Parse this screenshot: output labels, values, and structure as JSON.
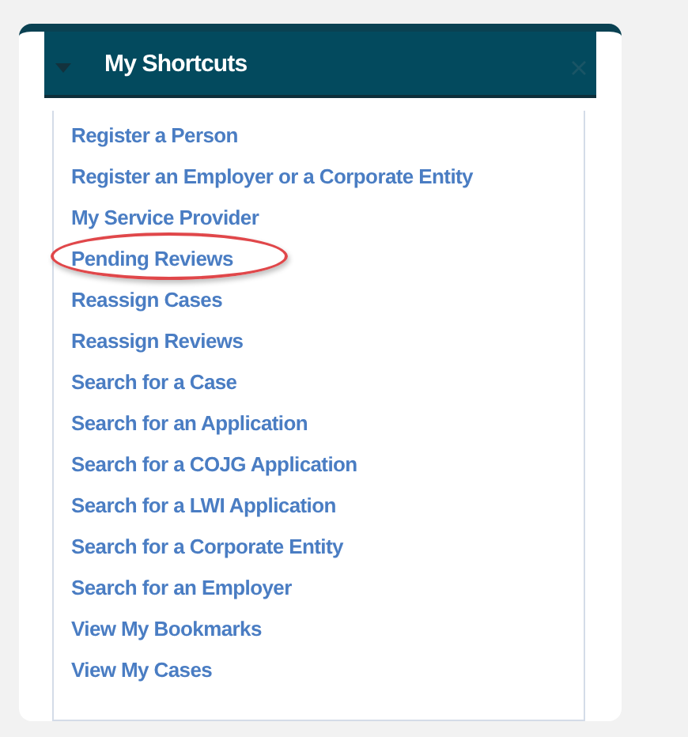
{
  "panel": {
    "title": "My Shortcuts"
  },
  "shortcuts": [
    {
      "label": "Register a Person",
      "circled": false
    },
    {
      "label": "Register an Employer or a Corporate Entity",
      "circled": false
    },
    {
      "label": "My Service Provider",
      "circled": false
    },
    {
      "label": "Pending Reviews",
      "circled": true
    },
    {
      "label": "Reassign Cases",
      "circled": false
    },
    {
      "label": "Reassign Reviews",
      "circled": false
    },
    {
      "label": "Search for a Case",
      "circled": false
    },
    {
      "label": "Search for an Application",
      "circled": false
    },
    {
      "label": "Search for a COJG Application",
      "circled": false
    },
    {
      "label": "Search for a LWI Application",
      "circled": false
    },
    {
      "label": "Search for a Corporate Entity",
      "circled": false
    },
    {
      "label": "Search for an Employer",
      "circled": false
    },
    {
      "label": "View My Bookmarks",
      "circled": false
    },
    {
      "label": "View My Cases",
      "circled": false
    }
  ]
}
